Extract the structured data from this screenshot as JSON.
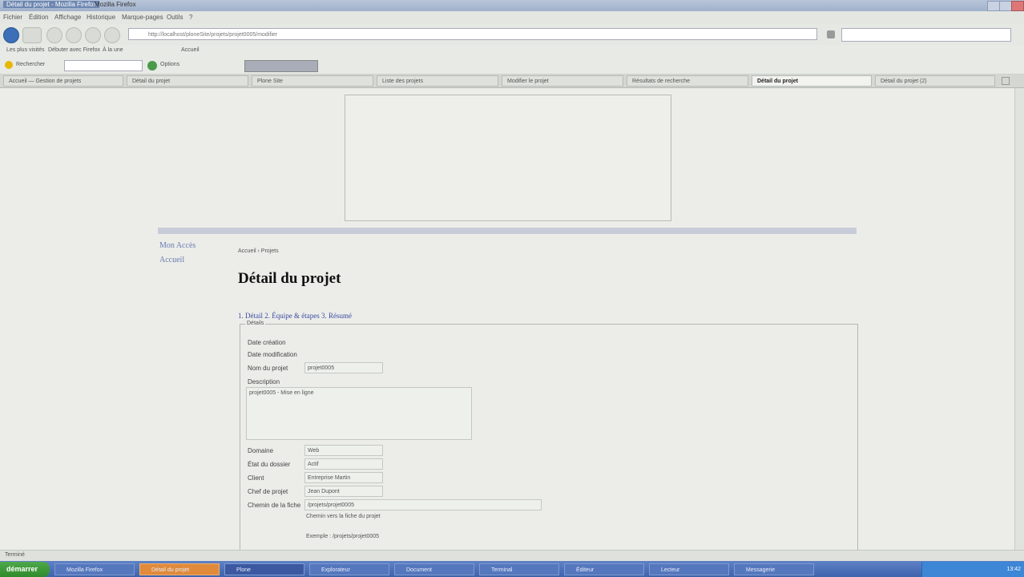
{
  "window": {
    "title": "Détail du projet - Mozilla Firefox",
    "title_secondary": "Mozilla Firefox"
  },
  "menu": [
    "Fichier",
    "Édition",
    "Affichage",
    "Historique",
    "Marque-pages",
    "Outils",
    "?"
  ],
  "navigation": {
    "url": "http://localhost/ploneSite/projets/projet0005/modifier",
    "search_placeholder": ""
  },
  "bookmarks": [
    "Les plus visités",
    "Débuter avec Firefox",
    "À la une",
    "Accueil"
  ],
  "toolbar2": {
    "search_value": "",
    "items": [
      "Rechercher",
      "Options"
    ]
  },
  "tabs": [
    {
      "label": "Accueil — Gestion de projets",
      "active": false
    },
    {
      "label": "Détail du projet",
      "active": false
    },
    {
      "label": "Plone Site",
      "active": false
    },
    {
      "label": "Liste des projets",
      "active": false
    },
    {
      "label": "Modifier le projet",
      "active": false
    },
    {
      "label": "Résultats de recherche",
      "active": false
    },
    {
      "label": "Détail du projet",
      "active": true
    },
    {
      "label": "Détail du projet (2)",
      "active": false
    }
  ],
  "page": {
    "sidebar_links": [
      "Mon Accès",
      "Accueil"
    ],
    "breadcrumb": "Accueil  ›  Projets",
    "heading": "Détail du projet",
    "steps": "1. Détail  2. Équipe & étapes  3. Résumé",
    "legend": "Détails",
    "form": {
      "date_creation_label": "Date création",
      "date_modif_label": "Date modification",
      "nom_label": "Nom du projet",
      "nom_value": "projet0005",
      "description_label": "Description",
      "description_value": "projet0005 - Mise en ligne",
      "domaine_label": "Domaine",
      "domaine_value": "Web",
      "etat_label": "État du dossier",
      "etat_value": "Actif",
      "client_label": "Client",
      "client_value": "Entreprise Martin",
      "chef_label": "Chef de projet",
      "chef_value": "Jean Dupont",
      "chemin_label": "Chemin de la fiche",
      "chemin_value": "/projets/projet0005",
      "hint_1": "Chemin vers la fiche du projet",
      "hint_2": "Exemple : /projets/projet0005"
    }
  },
  "status": {
    "left": "Terminé",
    "right": ""
  },
  "taskbar": {
    "start": "démarrer",
    "tasks": [
      {
        "label": "Mozilla Firefox",
        "style": "normal"
      },
      {
        "label": "Détail du projet",
        "style": "orange"
      },
      {
        "label": "Plone",
        "style": "active"
      },
      {
        "label": "Explorateur",
        "style": "normal"
      },
      {
        "label": "Document",
        "style": "normal"
      },
      {
        "label": "Terminal",
        "style": "normal"
      },
      {
        "label": "Éditeur",
        "style": "normal"
      },
      {
        "label": "Lecteur",
        "style": "normal"
      },
      {
        "label": "Messagerie",
        "style": "normal"
      }
    ],
    "clock": "13:42"
  }
}
